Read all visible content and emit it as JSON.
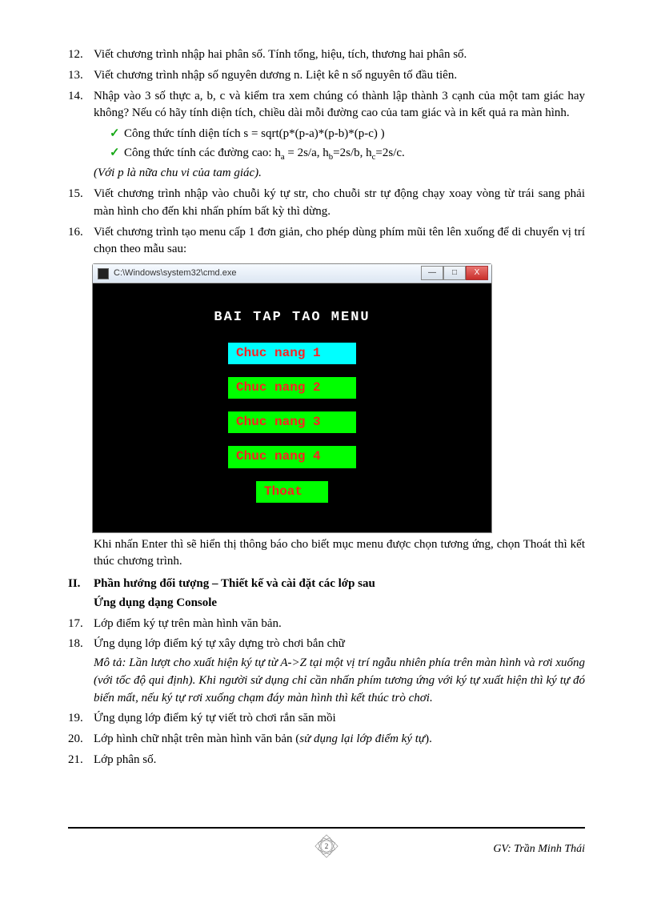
{
  "items": {
    "n12": "12.",
    "t12": "Viết chương trình nhập hai phân số. Tính tổng, hiệu, tích, thương hai phân số.",
    "n13": "13.",
    "t13": "Viết chương trình nhập số nguyên dương n. Liệt kê n số nguyên tố đầu tiên.",
    "n14": "14.",
    "t14": "Nhập vào 3 số thực a, b, c và kiểm tra xem chúng có thành lập thành 3 cạnh của một tam giác hay không? Nếu có hãy tính diện tích, chiều dài mỗi đường cao của tam giác và in kết quả ra màn hình.",
    "c14a": "Công thức tính diện tích s = sqrt(p*(p-a)*(p-b)*(p-c) )",
    "c14b_pre": "Công thức tính các đường cao: h",
    "c14b_a": "a",
    "c14b_mid1": " = 2s/a, h",
    "c14b_b": "b",
    "c14b_mid2": "=2s/b, h",
    "c14b_c": "c",
    "c14b_end": "=2s/c.",
    "c14note": "(Với p là nữa chu vi của tam giác).",
    "n15": "15.",
    "t15": "Viết chương trình nhập vào chuỗi ký tự str, cho chuỗi str tự động chạy xoay vòng từ trái sang phải màn hình cho đến khi nhấn phím bất kỳ thì dừng.",
    "n16": "16.",
    "t16": "Viết chương trình tạo menu cấp 1 đơn giản, cho phép dùng phím mũi tên lên xuống để di chuyển vị trí chọn theo mẫu sau:",
    "t16after": "Khi nhấn Enter thì sẽ hiển thị thông báo cho biết mục menu được chọn tương ứng, chọn Thoát thì kết thúc chương trình.",
    "n17": "17.",
    "t17": "Lớp điểm ký tự  trên màn hình văn bản.",
    "n18": "18.",
    "t18": "Ứng dụng lớp điểm ký tự xây dựng trò chơi bắn chữ",
    "t18desc": "Mô tả: Lần lượt cho xuất hiện ký tự từ A->Z tại một vị trí ngẫu nhiên phía trên màn hình và rơi xuống (với tốc độ qui định). Khi người sử dụng chỉ cần nhấn phím tương ứng với ký tự xuất hiện thì ký tự đó biến mất, nếu ký tự rơi xuống chạm đáy màn hình thì kết thúc trò chơi.",
    "n19": "19.",
    "t19": "Ứng dụng lớp điểm ký tự viết trò chơi rắn săn mồi",
    "n20": "20.",
    "t20_a": "Lớp hình chữ nhật trên màn hình văn bản (",
    "t20_b": "sử dụng lại lớp điểm ký tự",
    "t20_c": ").",
    "n21": "21.",
    "t21": "Lớp phân số."
  },
  "section": {
    "roman": "II.",
    "title": "Phần hướng đối tượng – Thiết kế và cài đặt các lớp sau",
    "subtitle": "Ứng dụng dạng Console"
  },
  "cmd": {
    "path": "C:\\Windows\\system32\\cmd.exe",
    "title": "BAI TAP TAO MENU",
    "m1": "Chuc nang 1",
    "m2": "Chuc nang 2",
    "m3": "Chuc nang 3",
    "m4": "Chuc nang 4",
    "m5": "Thoat",
    "btn_min": "—",
    "btn_max": "□",
    "btn_close": "X"
  },
  "footer": {
    "page": "2",
    "author": "GV: Trần Minh Thái"
  }
}
